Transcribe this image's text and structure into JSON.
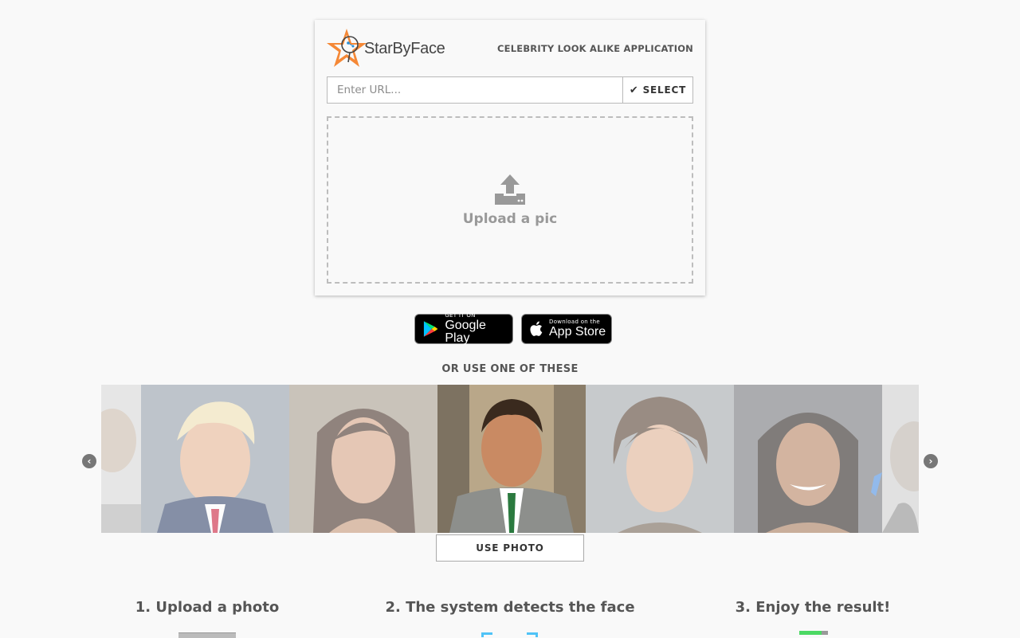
{
  "header": {
    "logo_text": "StarByFace",
    "tagline": "CELEBRITY LOOK ALIKE APPLICATION"
  },
  "url_form": {
    "placeholder": "Enter URL...",
    "value": "",
    "select_label": "SELECT"
  },
  "upload": {
    "label": "Upload a pic",
    "icon": "upload-icon"
  },
  "stores": {
    "google_small": "GET IT ON",
    "google_big": "Google Play",
    "apple_small": "Download on the",
    "apple_big": "App Store"
  },
  "examples": {
    "heading": "OR USE ONE OF THESE",
    "use_button": "USE PHOTO",
    "prev_icon": "chevron-left-icon",
    "next_icon": "chevron-right-icon"
  },
  "steps": [
    {
      "label": "1. Upload a photo"
    },
    {
      "label": "2. The system detects the face"
    },
    {
      "label": "3. Enjoy the result!"
    }
  ],
  "colors": {
    "background": "#f9f9f9",
    "text": "#555555",
    "border": "#b9b9b9"
  }
}
